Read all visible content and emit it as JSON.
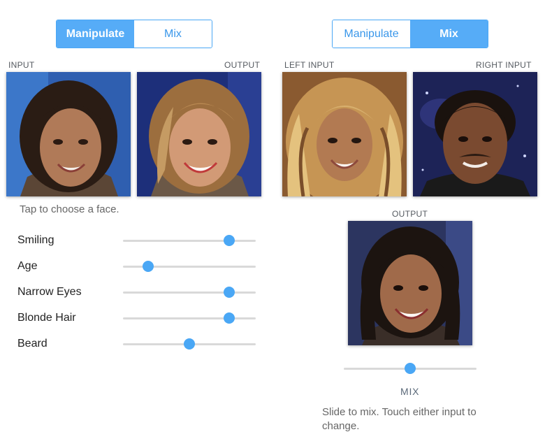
{
  "manipulate_panel": {
    "toggle": {
      "manipulate": "Manipulate",
      "mix": "Mix",
      "active": "manipulate"
    },
    "input_caption": "INPUT",
    "output_caption": "OUTPUT",
    "hint": "Tap to choose a face.",
    "sliders": [
      {
        "label": "Smiling",
        "value": 0.8
      },
      {
        "label": "Age",
        "value": 0.19
      },
      {
        "label": "Narrow Eyes",
        "value": 0.8
      },
      {
        "label": "Blonde Hair",
        "value": 0.8
      },
      {
        "label": "Beard",
        "value": 0.5
      }
    ]
  },
  "mix_panel": {
    "toggle": {
      "manipulate": "Manipulate",
      "mix": "Mix",
      "active": "mix"
    },
    "left_caption": "LEFT INPUT",
    "right_caption": "RIGHT INPUT",
    "output_caption": "OUTPUT",
    "mix_label": "MIX",
    "mix_value": 0.5,
    "hint": "Slide to mix. Touch either input to change."
  },
  "colors": {
    "accent": "#4aa7f5",
    "active_segment": "#56acf7",
    "track": "#d9d9d9"
  }
}
